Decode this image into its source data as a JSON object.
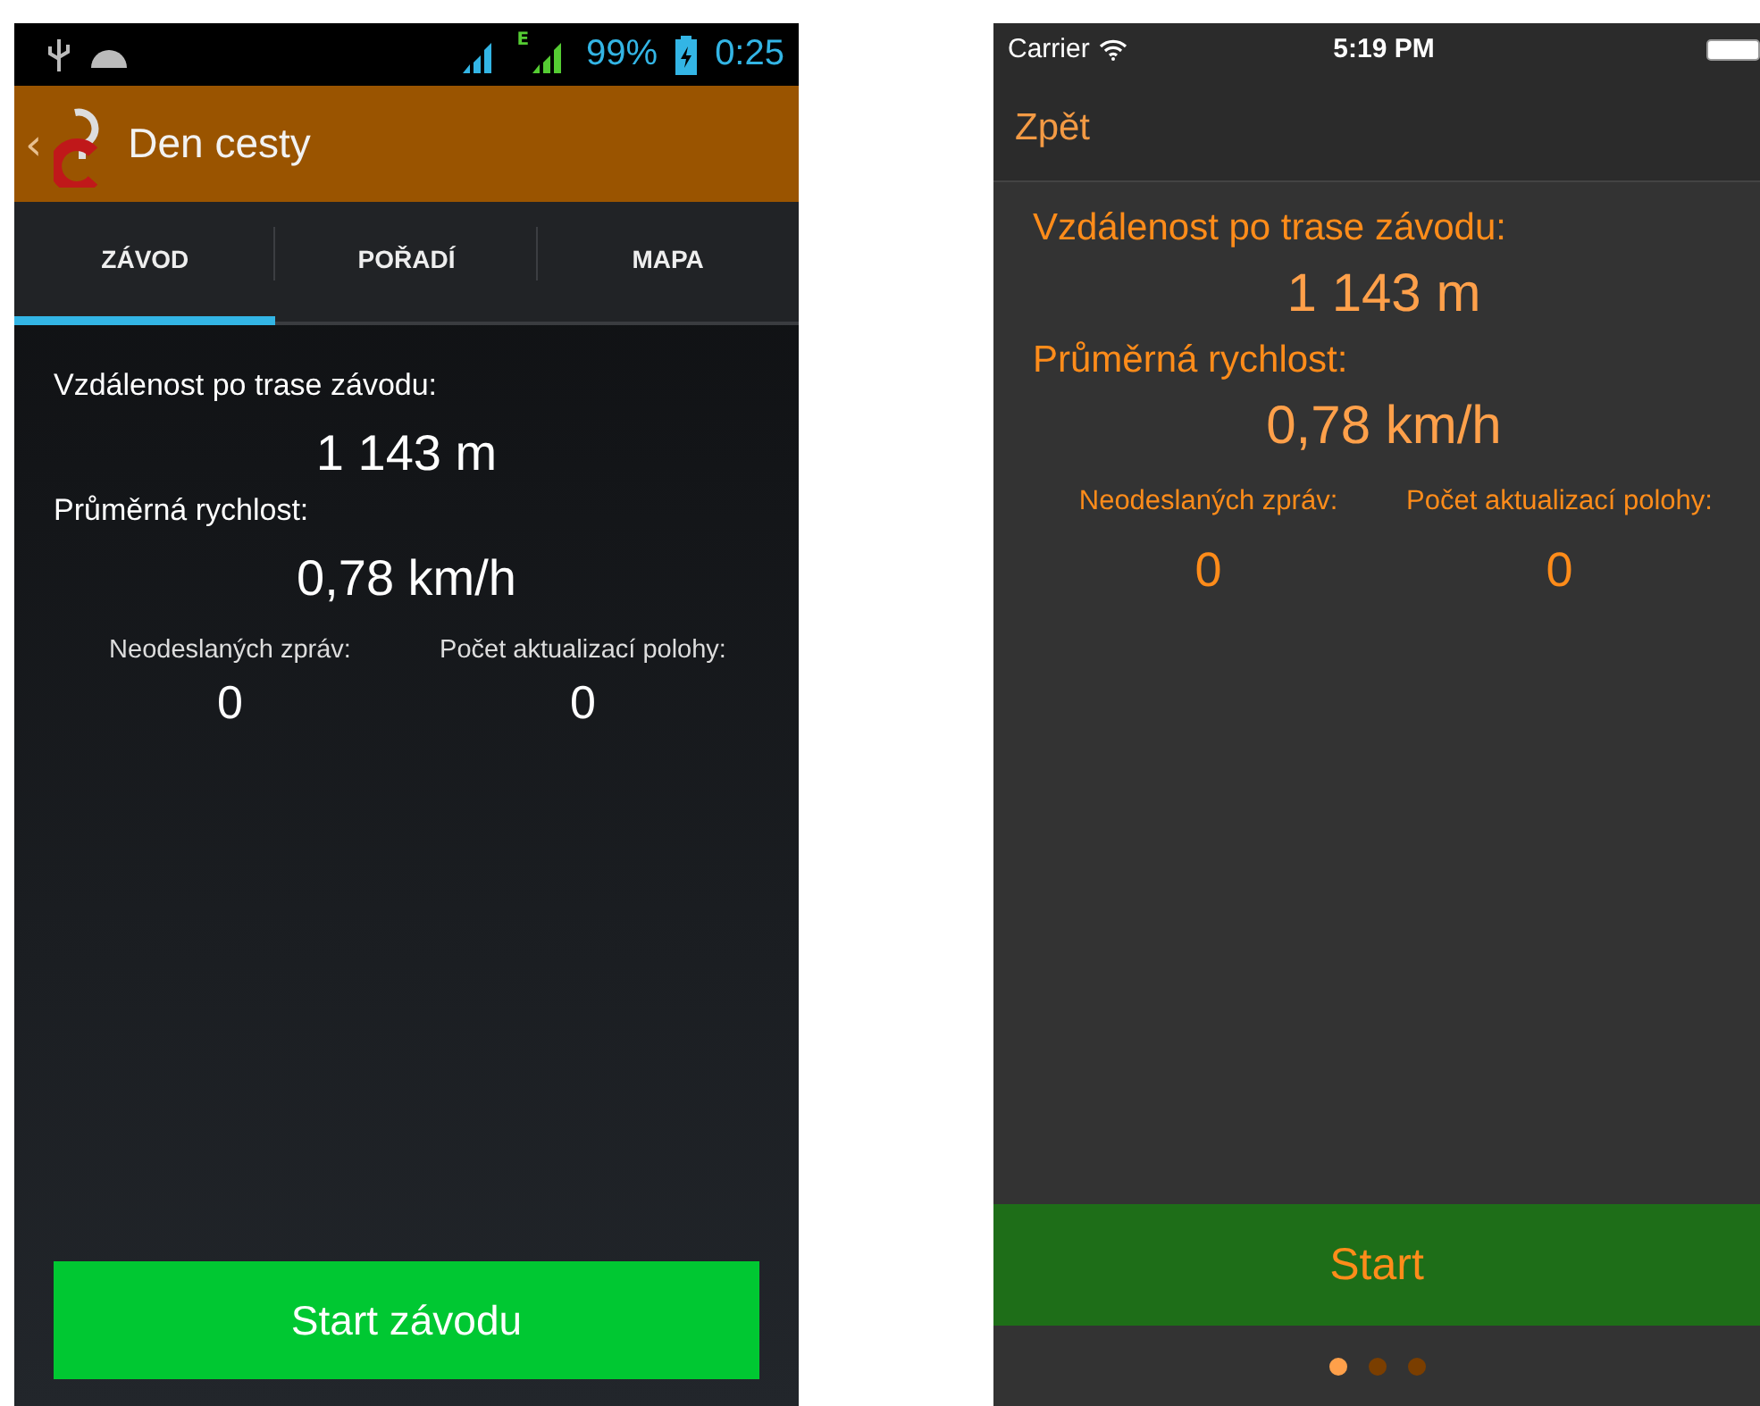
{
  "android": {
    "status_bar": {
      "network_type": "E",
      "battery": "99%",
      "time": "0:25"
    },
    "action_bar": {
      "back": "‹",
      "title": "Den cesty"
    },
    "tabs": [
      {
        "label": "ZÁVOD",
        "selected": true
      },
      {
        "label": "POŘADÍ",
        "selected": false
      },
      {
        "label": "MAPA",
        "selected": false
      }
    ],
    "distance_label": "Vzdálenost po trase závodu:",
    "distance": "1 143 m",
    "speed_label": "Průměrná rychlost:",
    "speed": "0,78 km/h",
    "stats": [
      {
        "label": "Neodeslaných zpráv:",
        "value": "0"
      },
      {
        "label": "Počet aktualizací polohy:",
        "value": "0"
      }
    ],
    "start_button": "Start závodu"
  },
  "ios": {
    "status_bar": {
      "carrier": "Carrier",
      "time": "5:19 PM"
    },
    "back": "Zpět",
    "distance_label": "Vzdálenost po trase závodu:",
    "distance": "1 143 m",
    "speed_label": "Průměrná rychlost:",
    "speed": "0,78 km/h",
    "stats": [
      {
        "label": "Neodeslaných zpráv:",
        "value": "0"
      },
      {
        "label": "Počet aktualizací polohy:",
        "value": "0"
      }
    ],
    "start_button": "Start",
    "page_dots": [
      {
        "selected": true
      },
      {
        "selected": false
      },
      {
        "selected": false
      }
    ]
  }
}
